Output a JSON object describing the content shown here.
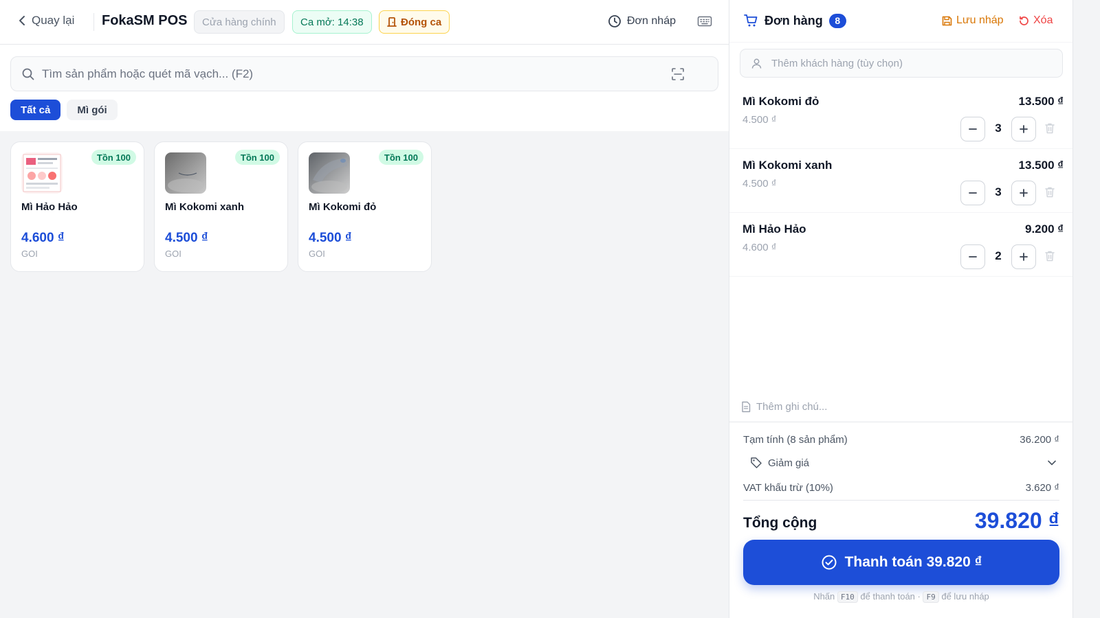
{
  "header": {
    "back_label": "Quay lại",
    "app_title": "FokaSM POS",
    "store_label": "Cửa hàng chính",
    "shift_label": "Ca mở: 14:38",
    "close_shift_label": "Đóng ca",
    "drafts_label": "Đơn nháp"
  },
  "search": {
    "placeholder": "Tìm sản phẩm hoặc quét mã vạch... (F2)",
    "value": ""
  },
  "categories": [
    {
      "label": "Tất cả",
      "active": true
    },
    {
      "label": "Mì gói",
      "active": false
    }
  ],
  "products": [
    {
      "name": "Mì Hảo Hảo",
      "price": "4.600 ₫",
      "unit": "GOI",
      "stock": "Tồn 100"
    },
    {
      "name": "Mì Kokomi xanh",
      "price": "4.500 ₫",
      "unit": "GOI",
      "stock": "Tồn 100"
    },
    {
      "name": "Mì Kokomi đỏ",
      "price": "4.500 ₫",
      "unit": "GOI",
      "stock": "Tồn 100"
    }
  ],
  "order": {
    "title": "Đơn hàng",
    "count": "8",
    "save_draft_label": "Lưu nháp",
    "clear_label": "Xóa",
    "customer_placeholder": "Thêm khách hàng (tùy chọn)",
    "items": [
      {
        "name": "Mì Kokomi đỏ",
        "unit_price": "4.500 ₫",
        "qty": "3",
        "total": "13.500 ₫"
      },
      {
        "name": "Mì Kokomi xanh",
        "unit_price": "4.500 ₫",
        "qty": "3",
        "total": "13.500 ₫"
      },
      {
        "name": "Mì Hảo Hảo",
        "unit_price": "4.600 ₫",
        "qty": "2",
        "total": "9.200 ₫"
      }
    ],
    "note_placeholder": "Thêm ghi chú...",
    "subtotal_label": "Tạm tính (8 sản phẩm)",
    "subtotal_value": "36.200 ₫",
    "discount_label": "Giảm giá",
    "vat_label": "VAT khấu trừ (10%)",
    "vat_value": "3.620 ₫",
    "total_label": "Tổng cộng",
    "total_value": "39.820 ₫",
    "pay_label": "Thanh toán 39.820 ₫",
    "hint": {
      "prefix": "Nhấn",
      "key_pay": "F10",
      "pay_text": "để thanh toán ·",
      "key_draft": "F9",
      "draft_text": "để lưu nháp"
    }
  },
  "colors": {
    "primary": "#1d4ed8",
    "success": "#047857",
    "warning": "#b45309",
    "danger": "#ef4444"
  }
}
